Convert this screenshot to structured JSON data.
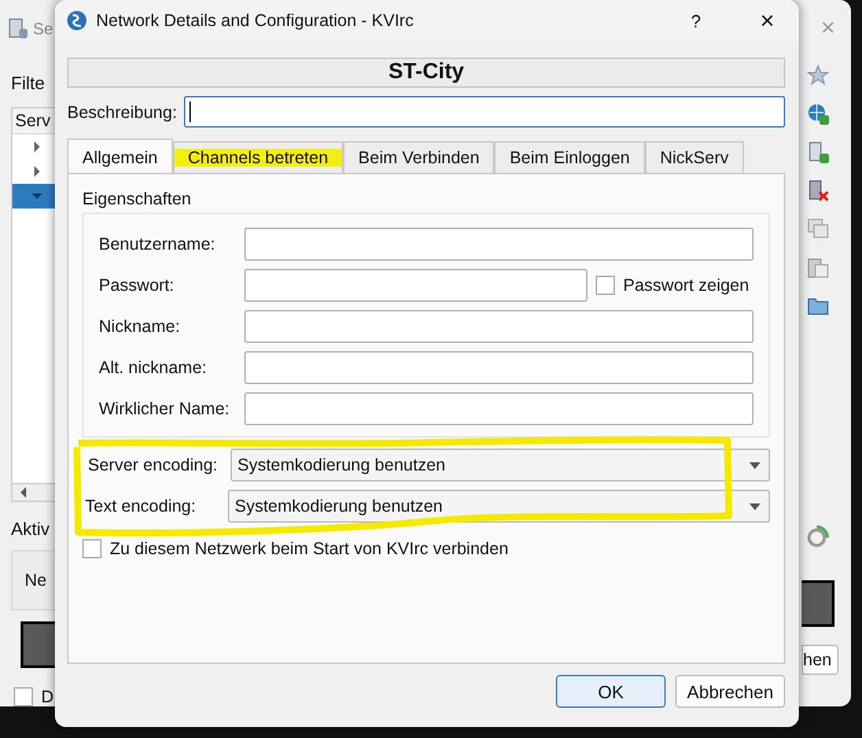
{
  "background_window": {
    "title": "Se",
    "filter_label": "Filte",
    "column_header": "Serv",
    "tree_rows": [
      {
        "selected": false
      },
      {
        "selected": false
      },
      {
        "selected": true
      }
    ],
    "close": "×",
    "active_label": "Aktiv",
    "network_button": "Ne",
    "checkbox": {
      "label": "D",
      "checked": false
    },
    "right_button": "hen"
  },
  "window": {
    "title": "Network Details and Configuration - KVIrc",
    "help": "?",
    "close": "×"
  },
  "network_name": "ST-City",
  "description": {
    "label": "Beschreibung:"
  },
  "tabs": [
    {
      "label": "Allgemein",
      "selected": true,
      "highlighted": false
    },
    {
      "label": "Channels betreten",
      "selected": false,
      "highlighted": true
    },
    {
      "label": "Beim Verbinden",
      "selected": false,
      "highlighted": false
    },
    {
      "label": "Beim Einloggen",
      "selected": false,
      "highlighted": false
    },
    {
      "label": "NickServ",
      "selected": false,
      "highlighted": false
    }
  ],
  "properties": {
    "title": "Eigenschaften",
    "fields": [
      {
        "label": "Benutzername:",
        "kind": "text"
      },
      {
        "label": "Passwort:",
        "kind": "password",
        "show_label": "Passwort zeigen",
        "checked": false
      },
      {
        "label": "Nickname:",
        "kind": "text"
      },
      {
        "label": "Alt. nickname:",
        "kind": "text"
      },
      {
        "label": "Wirklicher Name:",
        "kind": "text"
      }
    ]
  },
  "encodings": {
    "circled": true,
    "items": [
      {
        "label": "Server encoding:",
        "value": "Systemkodierung benutzen"
      },
      {
        "label": "Text encoding:",
        "value": "Systemkodierung benutzen"
      }
    ]
  },
  "autoconnect": {
    "label": "Zu diesem Netzwerk beim Start von KVIrc verbinden",
    "checked": false
  },
  "buttons": [
    {
      "label": "OK",
      "default": true
    },
    {
      "label": "Abbrechen",
      "default": false
    }
  ]
}
